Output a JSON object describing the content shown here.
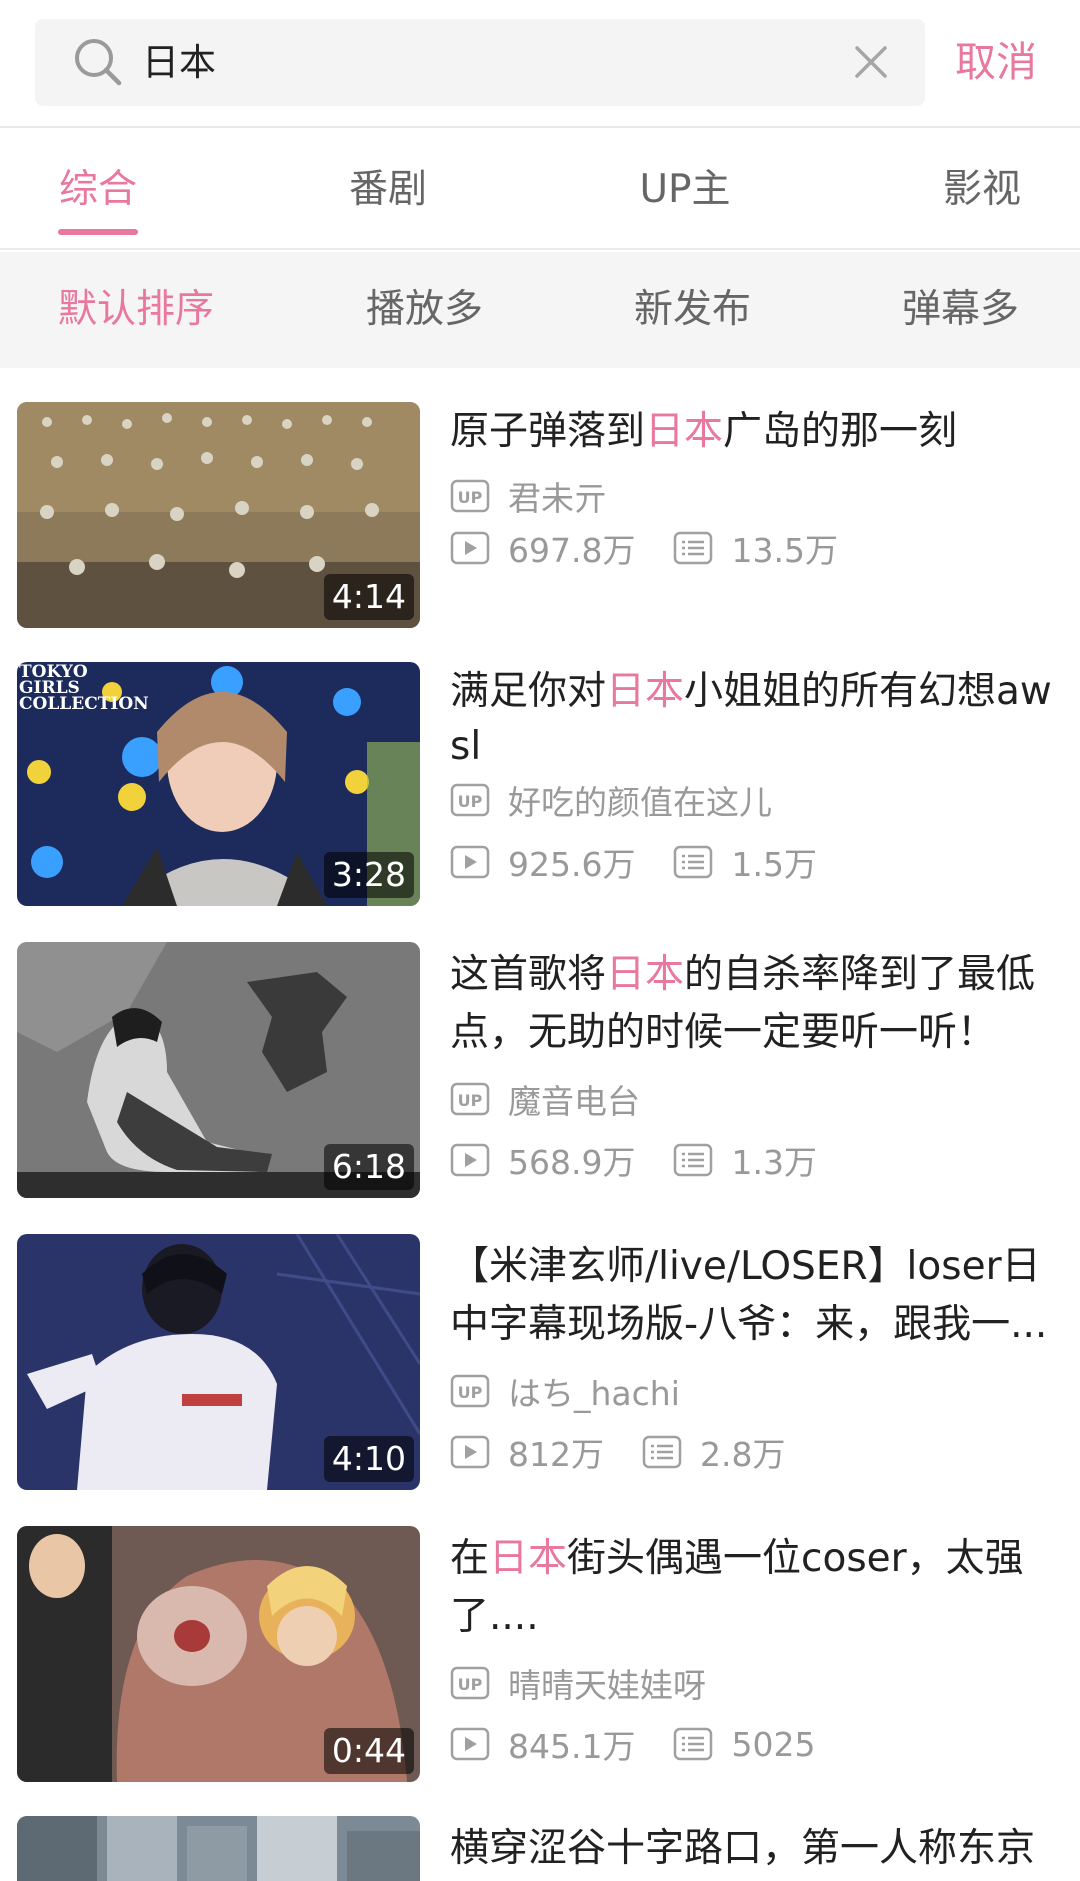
{
  "search": {
    "query": "日本",
    "cancel_label": "取消"
  },
  "tabs": [
    "综合",
    "番剧",
    "UP主",
    "影视"
  ],
  "sort_options": [
    "默认排序",
    "播放多",
    "新发布",
    "弹幕多"
  ],
  "videos": [
    {
      "title_before": "原子弹落到",
      "keyword": "日本",
      "title_after": "广岛的那一刻",
      "uploader": "君未亓",
      "plays": "697.8万",
      "danmaku": "13.5万",
      "duration": "4:14"
    },
    {
      "title_before": "满足你对",
      "keyword": "日本",
      "title_after": "小姐姐的所有幻想awsl",
      "uploader": "好吃的颜值在这儿",
      "plays": "925.6万",
      "danmaku": "1.5万",
      "duration": "3:28",
      "thumb_caption": "TOKYO GIRLS COLLECTION"
    },
    {
      "title_before": "这首歌将",
      "keyword": "日本",
      "title_after": "的自杀率降到了最低点，无助的时候一定要听一听！",
      "uploader": "魔音电台",
      "plays": "568.9万",
      "danmaku": "1.3万",
      "duration": "6:18"
    },
    {
      "title_before": "【米津玄师/live/LOSER】loser日中字幕现场版-八爷：来，跟我一...",
      "keyword": "",
      "title_after": "",
      "uploader": "はち_hachi",
      "plays": "812万",
      "danmaku": "2.8万",
      "duration": "4:10"
    },
    {
      "title_before": "在",
      "keyword": "日本",
      "title_after": "街头偶遇一位coser，太强了....",
      "uploader": "晴晴天娃娃呀",
      "plays": "845.1万",
      "danmaku": "5025",
      "duration": "0:44"
    },
    {
      "title_before": "横穿涩谷十字路口，第一人称东京",
      "keyword": "",
      "title_after": "",
      "uploader": "",
      "plays": "",
      "danmaku": "",
      "duration": ""
    }
  ],
  "icons": {
    "search": "search-icon",
    "clear": "close-icon",
    "uploader": "up-badge-icon",
    "plays": "play-count-icon",
    "danmaku": "danmaku-icon"
  },
  "colors": {
    "accent": "#e9789f",
    "text": "#212121",
    "secondary": "#999999",
    "sortbar_bg": "#f5f5f5",
    "search_bg": "#f4f4f4"
  }
}
